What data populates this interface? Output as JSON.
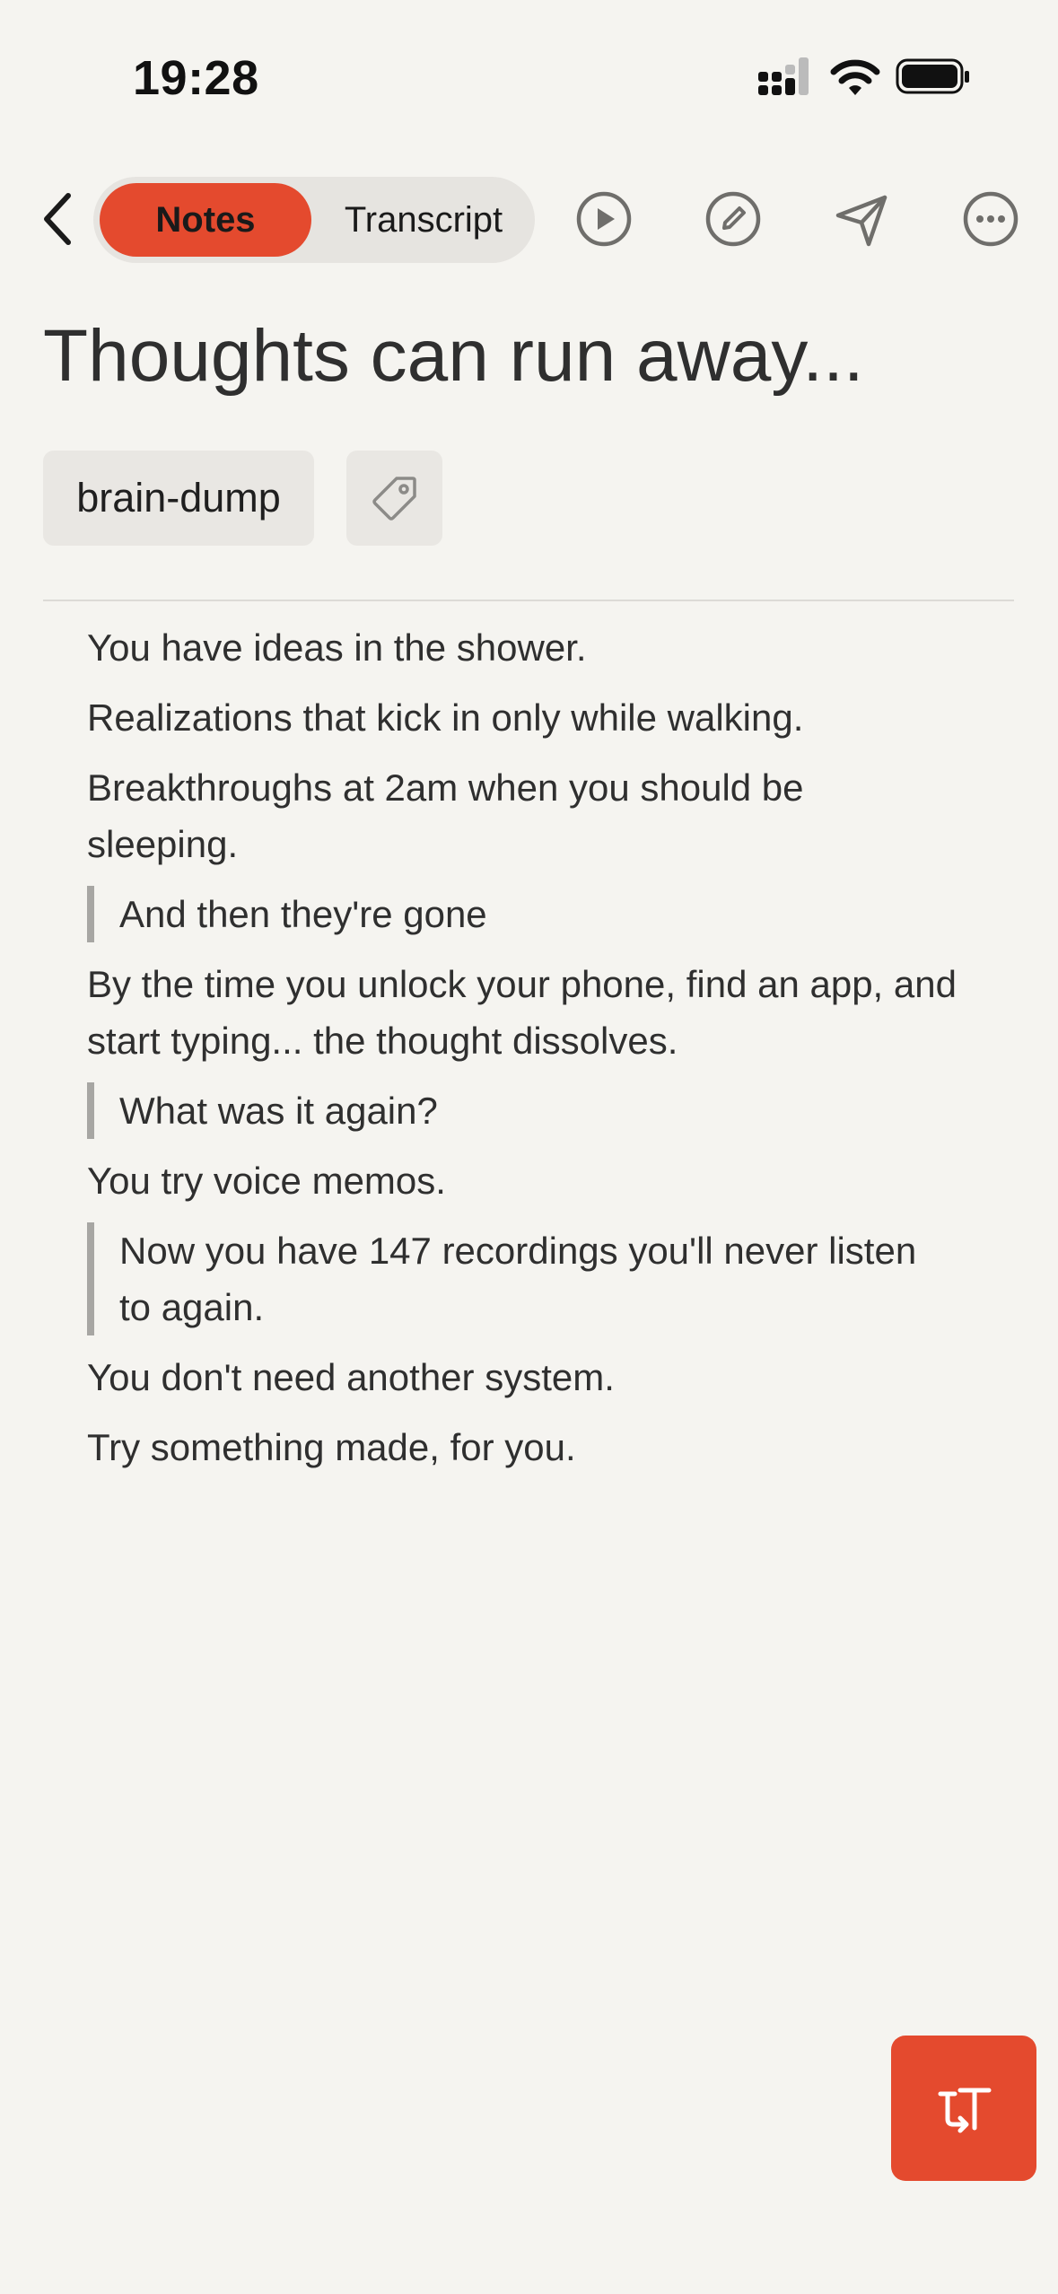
{
  "status_bar": {
    "time": "19:28"
  },
  "toolbar": {
    "tabs": [
      {
        "label": "Notes",
        "active": true
      },
      {
        "label": "Transcript",
        "active": false
      }
    ],
    "icons": [
      "back-chevron-icon",
      "play-icon",
      "edit-icon",
      "send-icon",
      "more-icon"
    ]
  },
  "note": {
    "title": "Thoughts can run away...",
    "tags": [
      "brain-dump"
    ],
    "blocks": [
      {
        "type": "p",
        "text": "You have ideas in the shower."
      },
      {
        "type": "p",
        "text": "Realizations that kick in only while walking."
      },
      {
        "type": "p",
        "text": "Breakthroughs at 2am when you should be sleeping."
      },
      {
        "type": "quote",
        "text": "And then they're gone"
      },
      {
        "type": "p",
        "text": "By the time you unlock your phone, find an app, and start typing... the thought dissolves."
      },
      {
        "type": "quote",
        "text": "What was it again?"
      },
      {
        "type": "p",
        "text": "You try voice memos."
      },
      {
        "type": "quote",
        "text": "Now you have 147 recordings you'll never listen to again."
      },
      {
        "type": "p",
        "text": "You don't need another system."
      },
      {
        "type": "p",
        "text": "Try something made, for you."
      }
    ]
  },
  "colors": {
    "accent": "#e44a2e",
    "background": "#f5f4f0",
    "quote_bar": "#a7a6a3"
  }
}
